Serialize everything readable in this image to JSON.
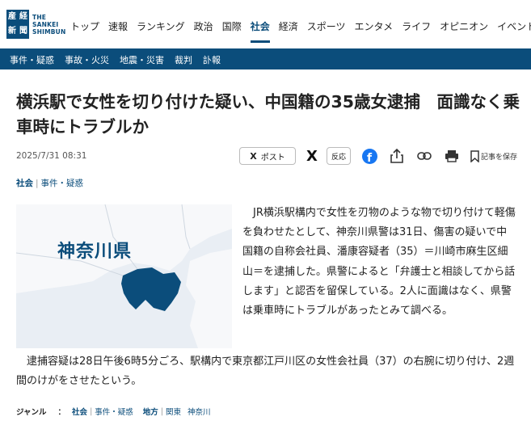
{
  "header": {
    "logo_chars": [
      "産",
      "経",
      "新",
      "聞"
    ],
    "logo_text_lines": [
      "THE",
      "SANKEI",
      "SHIMBUN"
    ],
    "nav": [
      "トップ",
      "速報",
      "ランキング",
      "政治",
      "国際",
      "社会",
      "経済",
      "スポーツ",
      "エンタメ",
      "ライフ",
      "オピニオン",
      "イベント"
    ],
    "active_nav": "社会"
  },
  "subnav": [
    "事件・疑惑",
    "事故・火災",
    "地震・災害",
    "裁判",
    "訃報"
  ],
  "article": {
    "title": "横浜駅で女性を切り付けた疑い、中国籍の35歳女逮捕　面識なく乗車時にトラブルか",
    "date": "2025/7/31 08:31",
    "category_main": "社会",
    "category_sub": "事件・疑惑",
    "map_label": "神奈川県",
    "paragraph1": "　JR横浜駅構内で女性を刃物のような物で切り付けて軽傷を負わせたとして、神奈川県警は31日、傷害の疑いで中国籍の自称会社員、潘康容疑者（35）＝川崎市麻生区細山＝を逮捕した。県警によると「弁護士と相談してから話します」と認否を留保している。2人に面識はなく、県警は乗車時にトラブルがあったとみて調べる。",
    "paragraph2": "　逮捕容疑は28日午後6時5分ごろ、駅構内で東京都江戸川区の女性会社員（37）の右腕に切り付け、2週間のけがをさせたという。"
  },
  "actions": {
    "post_label": "ポスト",
    "post_x": "X",
    "x_icon": "X",
    "hanno_label": "反応",
    "fb_letter": "f",
    "save_label": "記事を保存"
  },
  "genre": {
    "label": "ジャンル",
    "colon": "：",
    "genre_main": "社会",
    "genre_sub": "事件・疑惑",
    "region_label": "地方",
    "region_main": "関東",
    "region_sub": "神奈川"
  },
  "colors": {
    "brand": "#0b4d7b",
    "facebook": "#1877f2"
  }
}
